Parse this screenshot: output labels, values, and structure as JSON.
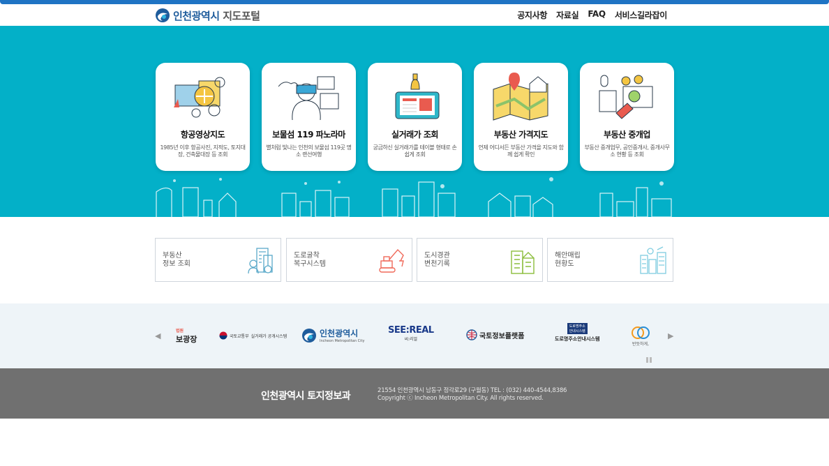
{
  "header": {
    "logo_main": "인천광역시",
    "logo_sub": "지도포털",
    "nav": [
      "공지사항",
      "자료실",
      "FAQ",
      "서비스길라잡이"
    ]
  },
  "cards": [
    {
      "title": "항공영상지도",
      "desc": "1985년 이후 항공사진, 지적도, 토지대장, 건축물대장 등 조회"
    },
    {
      "title": "보물섬 119 파노라마",
      "desc": "별처럼 빛나는 인천의 보물섬 119곳 명소 랜선여행"
    },
    {
      "title": "실거래가 조회",
      "desc": "궁금하신 실거래가를 테이블 형태로 손쉽게 조회"
    },
    {
      "title": "부동산 가격지도",
      "desc": "언제 어디서든 부동산 가격을 지도와 함께 쉽게 확인"
    },
    {
      "title": "부동산 중개업",
      "desc": "부동산 중개업무, 공인중개사, 중개사무소 현황 등 조회"
    }
  ],
  "quick_links": [
    {
      "line1": "부동산",
      "line2": "정보 조회",
      "icon": "building-money-icon",
      "color": "#5aa9c9"
    },
    {
      "line1": "도로굴착",
      "line2": "복구시스템",
      "icon": "excavator-icon",
      "color": "#f06a5a"
    },
    {
      "line1": "도시경관",
      "line2": "변천기록",
      "icon": "city-building-icon",
      "color": "#8cbd3c"
    },
    {
      "line1": "해안매립",
      "line2": "현황도",
      "icon": "coastal-city-icon",
      "color": "#7fcde0"
    }
  ],
  "partners": {
    "p1_small": "법원",
    "p1_main": "보광장",
    "p2_main": "국토교통부",
    "p2_sub": "실거래가 공개시스템",
    "p3_main": "인천광역시",
    "p3_sub": "Incheon Metropolitan City",
    "p4_main": "SEE:REAL",
    "p4_sub": "씨:리얼",
    "p5_main": "국토정보플랫폼",
    "p6_box1": "도로명주소",
    "p6_box2": "안내시스템",
    "p6_main": "도로명주소안내시스템",
    "p7_sub": "반듯하게,"
  },
  "footer": {
    "title": "인천광역시 토지정보과",
    "address": "21554 인천광역시 남동구 정각로29 (구월동) TEL : (032) 440-4544,8386",
    "copyright": "Copyright ⓒ Incheon Metropolitan City. All rights reserved."
  },
  "colors": {
    "hero": "#03b0c8",
    "accent_blue": "#1f74c4",
    "footer": "#707070"
  }
}
